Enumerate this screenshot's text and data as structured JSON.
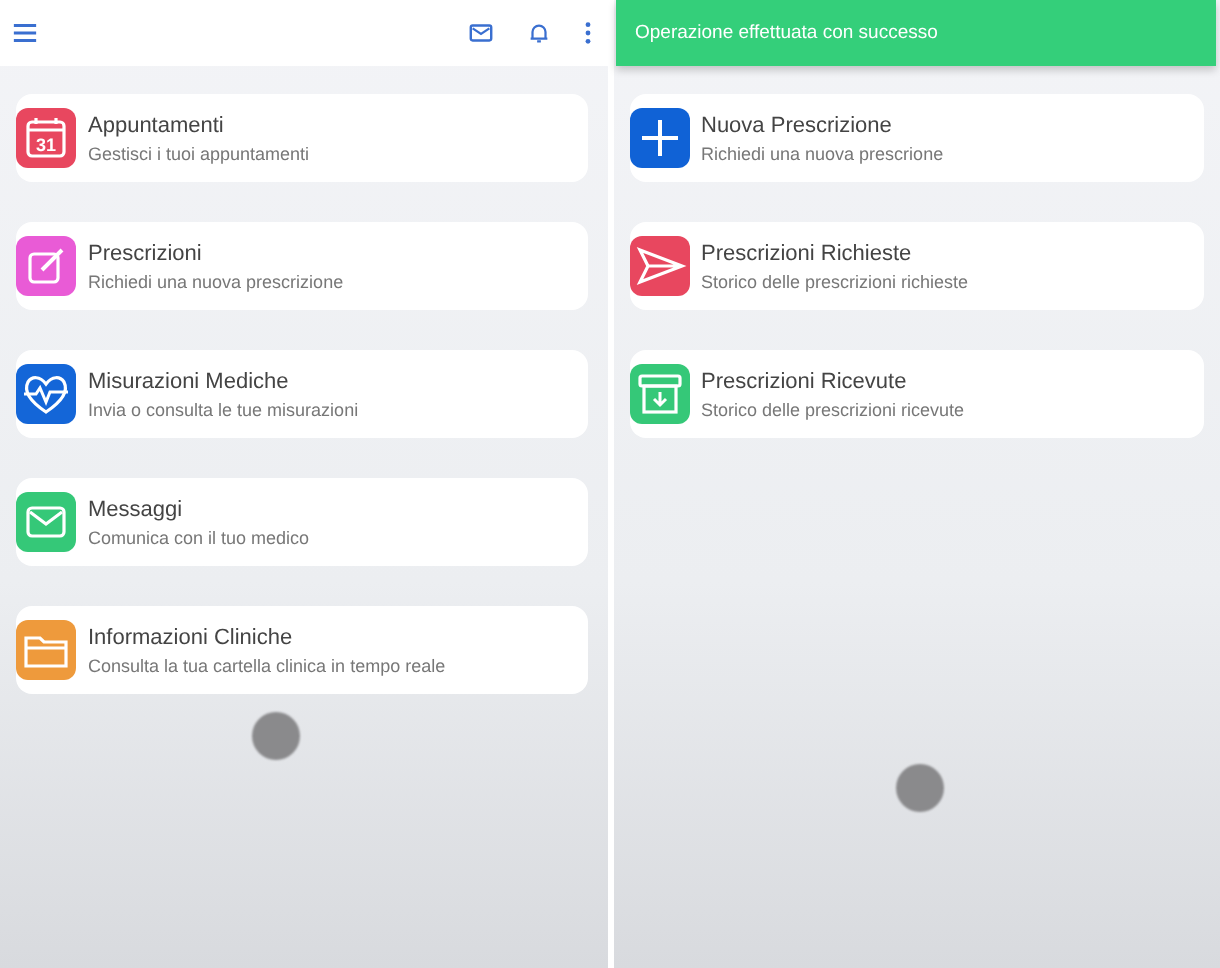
{
  "left_screen": {
    "menu": [
      {
        "title": "Appuntamenti",
        "subtitle": "Gestisci i tuoi appuntamenti",
        "color": "#e8475f",
        "icon_text": "31"
      },
      {
        "title": "Prescrizioni",
        "subtitle": "Richiedi una nuova prescrizione",
        "color": "#e95bd6"
      },
      {
        "title": "Misurazioni Mediche",
        "subtitle": "Invia o consulta le tue misurazioni",
        "color": "#1466d8"
      },
      {
        "title": "Messaggi",
        "subtitle": "Comunica con il tuo medico",
        "color": "#35c878"
      },
      {
        "title": "Informazioni Cliniche",
        "subtitle": "Consulta la tua cartella clinica in tempo reale",
        "color": "#ee9a3c"
      }
    ]
  },
  "right_screen": {
    "toast": "Operazione effettuata con successo",
    "menu": [
      {
        "title": "Nuova Prescrizione",
        "subtitle": "Richiedi una nuova prescrione",
        "color": "#1062d6"
      },
      {
        "title": "Prescrizioni Richieste",
        "subtitle": "Storico delle prescrizioni richieste",
        "color": "#e8475f"
      },
      {
        "title": "Prescrizioni Ricevute",
        "subtitle": "Storico delle prescrizioni ricevute",
        "color": "#35c878"
      }
    ]
  }
}
